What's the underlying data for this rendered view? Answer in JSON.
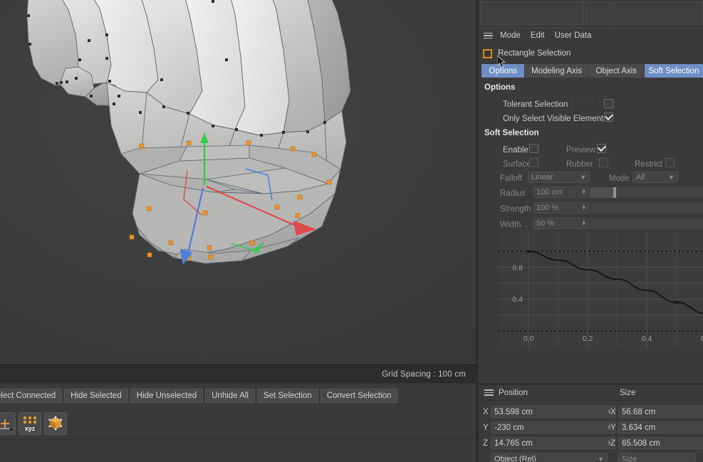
{
  "viewport": {
    "status_text": "Grid Spacing : 100 cm",
    "icons": {
      "axis": "move-axis-icon",
      "points": "xyz-points-icon",
      "cube": "object-cube-icon"
    }
  },
  "command_bar": {
    "buttons": [
      {
        "label": "elect Connected",
        "name": "select-connected-button"
      },
      {
        "label": "Hide Selected",
        "name": "hide-selected-button"
      },
      {
        "label": "Hide Unselected",
        "name": "hide-unselected-button"
      },
      {
        "label": "Unhide All",
        "name": "unhide-all-button"
      },
      {
        "label": "Set Selection",
        "name": "set-selection-button"
      },
      {
        "label": "Convert Selection",
        "name": "convert-selection-button"
      }
    ]
  },
  "attributes": {
    "menu": {
      "mode": "Mode",
      "edit": "Edit",
      "user_data": "User Data"
    },
    "object_title": "Rectangle Selection",
    "tabs": [
      {
        "label": "Options",
        "active": true
      },
      {
        "label": "Modeling Axis",
        "active": false
      },
      {
        "label": "Object Axis",
        "active": false
      },
      {
        "label": "Soft Selection",
        "active": true
      }
    ],
    "options": {
      "heading": "Options",
      "tolerant_selection": {
        "label": "Tolerant Selection",
        "dots": ". . . . . . . .",
        "checked": false
      },
      "only_select_visible": {
        "label": "Only Select Visible Elements",
        "checked": true
      }
    },
    "soft_selection": {
      "heading": "Soft Selection",
      "enable": {
        "label": "Enable",
        "checked": false
      },
      "preview": {
        "label": "Preview",
        "checked": true
      },
      "surface": {
        "label": "Surface",
        "checked": false
      },
      "rubber": {
        "label": "Rubber",
        "checked": false
      },
      "restrict": {
        "label": "Restrict",
        "checked": false
      },
      "falloff": {
        "label": "Falloff",
        "value": "Linear"
      },
      "mode": {
        "label": "Mode",
        "value": "All"
      },
      "radius": {
        "label": "Radius",
        "value": "100 cm"
      },
      "strength": {
        "label": "Strength",
        "value": "100 %"
      },
      "width": {
        "label": "Width. .",
        "value": "50 %"
      }
    }
  },
  "chart_data": {
    "type": "line",
    "title": "",
    "xlabel": "",
    "ylabel": "",
    "x": [
      0.0,
      0.1,
      0.2,
      0.3,
      0.4,
      0.5,
      0.6
    ],
    "y": [
      1.0,
      0.89,
      0.77,
      0.65,
      0.51,
      0.36,
      0.22
    ],
    "xticks": [
      0.0,
      0.2,
      0.4
    ],
    "xtick_labels": [
      "0.0",
      "0.2",
      "0.4"
    ],
    "yticks": [
      0.4,
      0.8
    ],
    "ytick_labels": [
      "0.4",
      "0.8"
    ],
    "xlim": [
      -0.04,
      0.64
    ],
    "ylim": [
      0.0,
      1.08
    ],
    "grid": true,
    "legend": "none",
    "line_color": "#141414",
    "points": [
      {
        "x": 0.0,
        "y": 1.0
      },
      {
        "x": 0.5,
        "y": 0.36
      }
    ]
  },
  "position_panel": {
    "col1_label": "Position",
    "col2_label": "Size",
    "position": [
      {
        "axis": "X",
        "value": "53.598 cm"
      },
      {
        "axis": "Y",
        "value": "-230 cm"
      },
      {
        "axis": "Z",
        "value": "14.765 cm"
      }
    ],
    "size": [
      {
        "axis": "X",
        "value": "56.68 cm"
      },
      {
        "axis": "Y",
        "value": "3.634 cm"
      },
      {
        "axis": "Z",
        "value": "65.508 cm"
      }
    ],
    "coord_mode": "Object (Rel)",
    "size_mode": "Size"
  },
  "colors": {
    "accent_blue": "#6f8ec4",
    "vertex_orange": "#f0922b",
    "axis_x": "#e04a4a",
    "axis_y": "#36cc52",
    "axis_z": "#4a7fe0",
    "panel_bg": "#3a3a3a"
  }
}
